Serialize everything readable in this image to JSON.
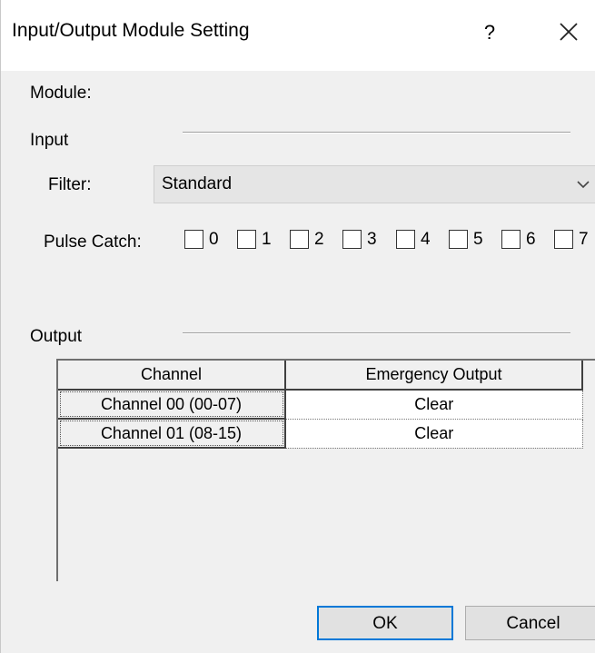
{
  "window": {
    "title": "Input/Output Module Setting",
    "help_label": "?"
  },
  "module": {
    "label": "Module:"
  },
  "input": {
    "section_label": "Input",
    "filter_label": "Filter:",
    "filter_value": "Standard",
    "pulse_catch_label": "Pulse Catch:",
    "pulse_catch": [
      {
        "label": "0",
        "checked": false
      },
      {
        "label": "1",
        "checked": false
      },
      {
        "label": "2",
        "checked": false
      },
      {
        "label": "3",
        "checked": false
      },
      {
        "label": "4",
        "checked": false
      },
      {
        "label": "5",
        "checked": false
      },
      {
        "label": "6",
        "checked": false
      },
      {
        "label": "7",
        "checked": false
      }
    ]
  },
  "output": {
    "section_label": "Output",
    "columns": [
      "Channel",
      "Emergency Output"
    ],
    "rows": [
      {
        "channel": "Channel 00 (00-07)",
        "emergency_output": "Clear"
      },
      {
        "channel": "Channel 01 (08-15)",
        "emergency_output": "Clear"
      }
    ]
  },
  "buttons": {
    "ok": "OK",
    "cancel": "Cancel"
  }
}
